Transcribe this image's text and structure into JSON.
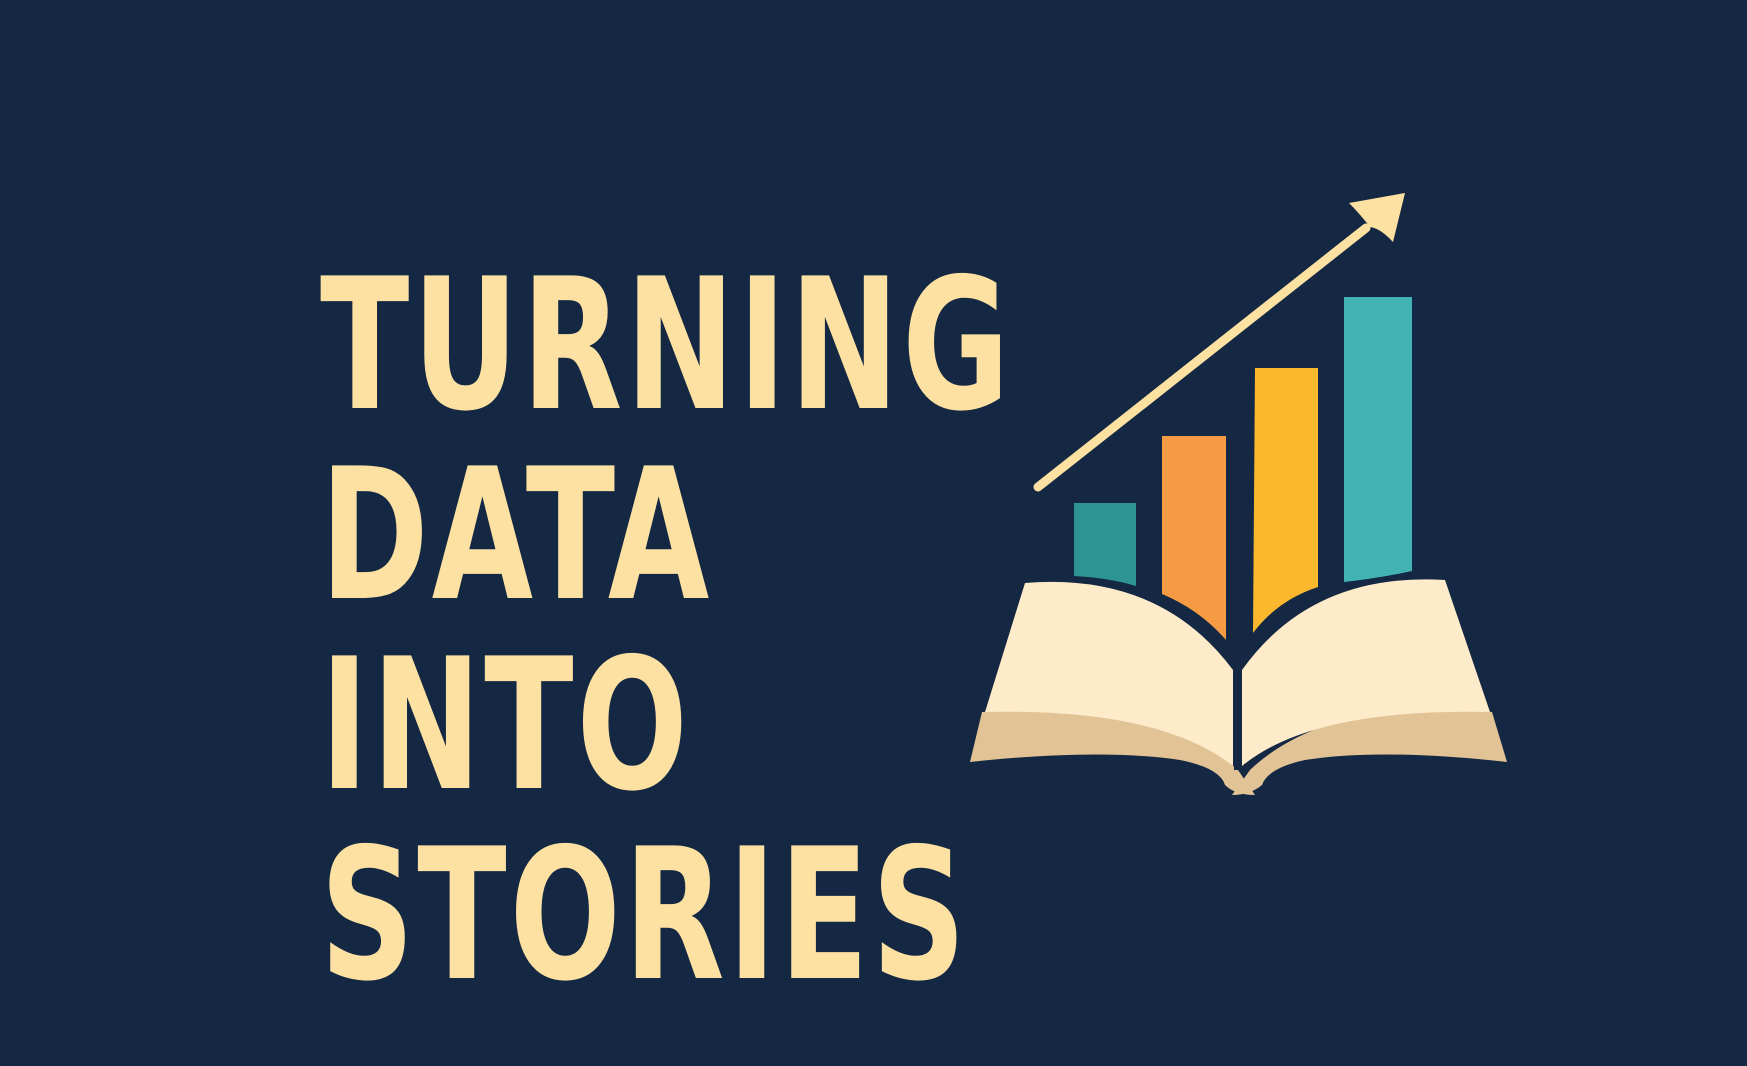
{
  "headline": {
    "lines": [
      "TURNING",
      "DATA",
      "INTO",
      "STORIES"
    ]
  },
  "colors": {
    "background": "#142843",
    "text": "#FDE1A2",
    "bar_teal_dark": "#2E9492",
    "bar_orange": "#F59B43",
    "bar_yellow": "#FBB72D",
    "bar_teal_light": "#43B2B2",
    "book_pages": "#FDEBC9",
    "book_edge": "#E1C396",
    "arrow": "#FDE1A2"
  },
  "illustration": {
    "bar_levels": [
      0.25,
      0.5,
      0.7,
      1.0
    ],
    "icons": [
      "book-icon",
      "bar-chart-icon",
      "trend-arrow-icon"
    ]
  }
}
